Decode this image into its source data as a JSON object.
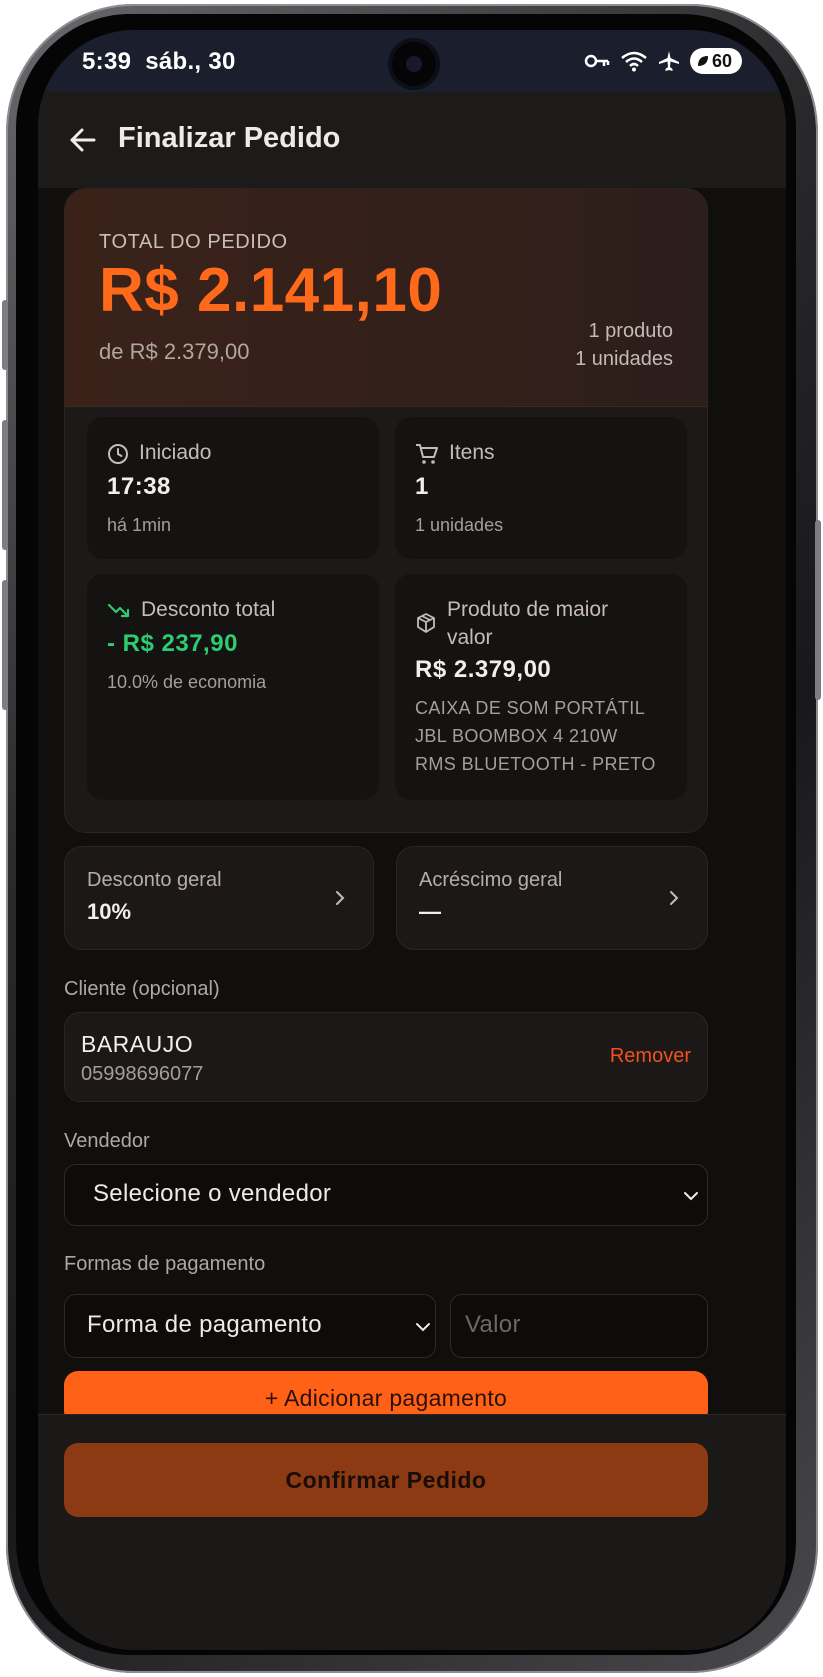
{
  "status_bar": {
    "time": "5:39",
    "date": "sáb., 30",
    "battery": "60"
  },
  "header": {
    "title": "Finalizar Pedido"
  },
  "summary": {
    "total_label": "TOTAL DO PEDIDO",
    "total_value": "R$ 2.141,10",
    "original_value": "de R$ 2.379,00",
    "product_count": "1 produto",
    "unit_count": "1 unidades"
  },
  "stats": {
    "started": {
      "label": "Iniciado",
      "value": "17:38",
      "sub": "há 1min"
    },
    "items": {
      "label": "Itens",
      "value": "1",
      "sub": "1 unidades"
    },
    "discount": {
      "label": "Desconto total",
      "value": "- R$ 237,90",
      "sub": "10.0% de economia"
    },
    "top_product": {
      "label_line1": "Produto de maior",
      "label_line2": "valor",
      "value": "R$ 2.379,00",
      "name_line1": "CAIXA DE SOM PORTÁTIL",
      "name_line2": "JBL BOOMBOX 4 210W",
      "name_line3": "RMS BLUETOOTH - PRETO"
    }
  },
  "adjustments": {
    "discount": {
      "label": "Desconto geral",
      "value": "10%"
    },
    "surcharge": {
      "label": "Acréscimo geral",
      "value": "—"
    }
  },
  "client": {
    "section_label": "Cliente (opcional)",
    "name": "BARAUJO",
    "document": "05998696077",
    "remove_label": "Remover"
  },
  "seller": {
    "section_label": "Vendedor",
    "placeholder": "Selecione o vendedor"
  },
  "payment": {
    "section_label": "Formas de pagamento",
    "method_placeholder": "Forma de pagamento",
    "amount_placeholder": "Valor",
    "add_label": "+ Adicionar pagamento"
  },
  "footer": {
    "confirm_label": "Confirmar Pedido"
  },
  "colors": {
    "accent": "#ff6a1a",
    "success": "#2ecc71",
    "danger": "#f0521f",
    "confirm_disabled": "#8c3a14"
  }
}
